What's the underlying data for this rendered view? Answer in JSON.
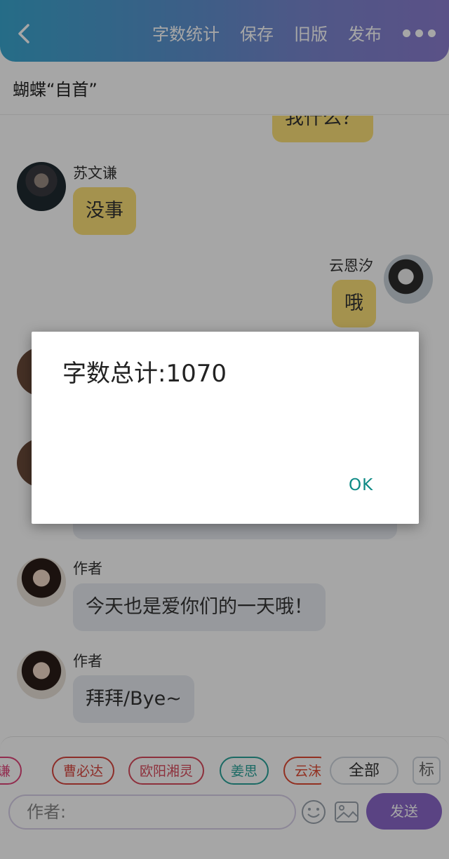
{
  "header": {
    "back_icon": "back-chevron-icon",
    "buttons": [
      "字数统计",
      "保存",
      "旧版",
      "发布"
    ],
    "more_icon": "more-dots-icon",
    "gradient": [
      "#3aa7cf",
      "#8b7dcf"
    ]
  },
  "title": "蝴蝶“自首”",
  "chat": {
    "partial_bubble": "我什么？",
    "messages": [
      {
        "sender": "苏文谦",
        "text": "没事",
        "side": "left",
        "bubble_color": "#fce079"
      },
      {
        "sender": "云恩汐",
        "text": "哦",
        "side": "right",
        "bubble_color": "#fce079"
      },
      {
        "sender": "作者",
        "text": "今天也是爱你们的一天哦！",
        "side": "left",
        "bubble_color": "#e8ecf2"
      },
      {
        "sender": "作者",
        "text": "拜拜/Bye~",
        "side": "left",
        "bubble_color": "#e8ecf2"
      }
    ]
  },
  "bottom": {
    "tags": [
      {
        "label": "谦",
        "color": "#e0457a"
      },
      {
        "label": "曹必达",
        "color": "#d9473f"
      },
      {
        "label": "欧阳湘灵",
        "color": "#d94b5c"
      },
      {
        "label": "姜思",
        "color": "#2aa39a"
      },
      {
        "label": "云沫",
        "color": "#e04b34"
      }
    ],
    "all_label": "全部",
    "mark_label": "标",
    "input_placeholder": "作者:",
    "emoji_icon": "smiley-icon",
    "image_icon": "image-icon",
    "send_label": "发送",
    "send_color": "#8a68c9"
  },
  "dialog": {
    "message": "字数总计:1070",
    "ok_label": "OK",
    "ok_color": "#0d8a85"
  }
}
